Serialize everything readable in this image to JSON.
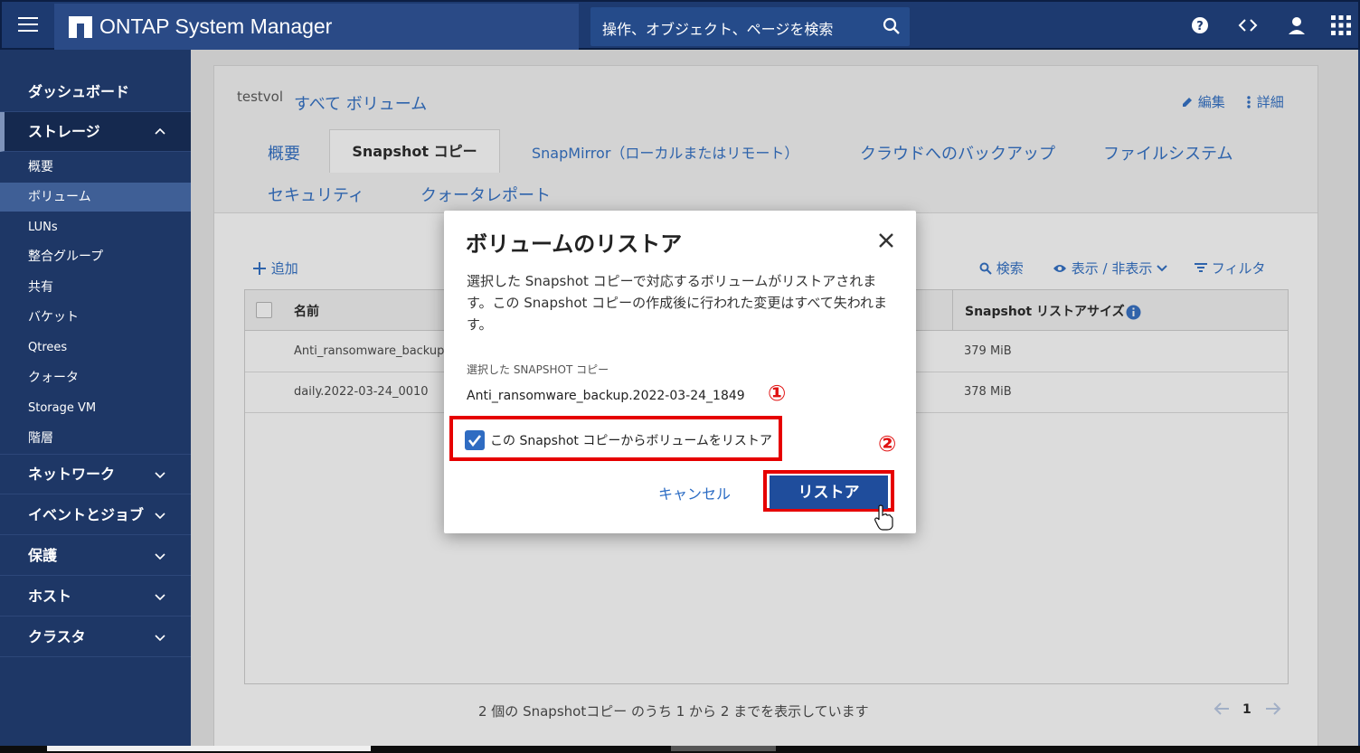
{
  "topbar": {
    "title": "ONTAP System Manager",
    "search_placeholder": "操作、オブジェクト、ページを検索"
  },
  "sidebar": {
    "items": [
      {
        "label": "ダッシュボード"
      },
      {
        "label": "ストレージ"
      },
      {
        "label": "概要"
      },
      {
        "label": "ボリューム"
      },
      {
        "label": "LUNs"
      },
      {
        "label": "整合グループ"
      },
      {
        "label": "共有"
      },
      {
        "label": "バケット"
      },
      {
        "label": "Qtrees"
      },
      {
        "label": "クォータ"
      },
      {
        "label": "Storage VM"
      },
      {
        "label": "階層"
      },
      {
        "label": "ネットワーク"
      },
      {
        "label": "イベントとジョブ"
      },
      {
        "label": "保護"
      },
      {
        "label": "ホスト"
      },
      {
        "label": "クラスタ"
      }
    ]
  },
  "header": {
    "volume_name": "testvol",
    "all_volumes_link": "すべて ボリューム",
    "edit_label": "編集",
    "more_label": "詳細"
  },
  "tabs": [
    {
      "label": "概要"
    },
    {
      "label": "Snapshot コピー"
    },
    {
      "label": "SnapMirror（ローカルまたはリモート）"
    },
    {
      "label": "クラウドへのバックアップ"
    },
    {
      "label": "ファイルシステム"
    },
    {
      "label": "セキュリティ"
    },
    {
      "label": "クォータレポート"
    }
  ],
  "toolbar": {
    "add_label": "追加",
    "search_label": "検索",
    "show_hide_label": "表示 / 非表示",
    "filter_label": "フィルタ"
  },
  "table": {
    "columns": [
      "名前",
      "Snapshot リストアサイズ"
    ],
    "rows": [
      {
        "name": "Anti_ransomware_backup.2",
        "size": "379 MiB"
      },
      {
        "name": "daily.2022-03-24_0010",
        "size": "378 MiB"
      }
    ]
  },
  "footer": {
    "summary": "2 個の Snapshotコピー のうち 1 から 2 までを表示しています",
    "page": "1"
  },
  "modal": {
    "title": "ボリュームのリストア",
    "description": "選択した Snapshot コピーで対応するボリュームがリストアされます。この Snapshot コピーの作成後に行われた変更はすべて失われます。",
    "selected_label": "選択した SNAPSHOT コピー",
    "selected_value": "Anti_ransomware_backup.2022-03-24_1849",
    "checkbox_label": "この Snapshot コピーからボリュームをリストア",
    "checkbox_checked": true,
    "cancel_label": "キャンセル",
    "restore_label": "リストア",
    "marker_1": "①",
    "marker_2": "②"
  },
  "colors": {
    "topbar": "#1d3a70",
    "sidebar": "#1e3766",
    "accent": "#2b6cc4",
    "primary_button": "#1f4d9c",
    "highlight": "#e60000"
  }
}
